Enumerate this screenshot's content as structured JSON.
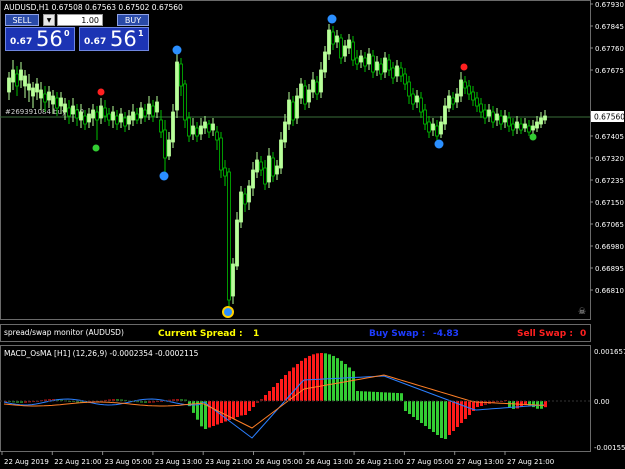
{
  "chart": {
    "header": "AUDUSD,H1  0.67508 0.67563 0.67502 0.67560",
    "symbol_icon": "chevron-down-icon",
    "price_labels": [
      "0.67930",
      "0.67845",
      "0.67760",
      "0.67675",
      "0.67560",
      "0.67490",
      "0.67405",
      "0.67320",
      "0.67235",
      "0.67150",
      "0.67065",
      "0.66980",
      "0.66895",
      "0.66810"
    ],
    "current_price": "0.67560",
    "order_line_label": "#269391084 buy 1.00",
    "order_line_color": "#3a6e3a",
    "bull_color": "#b8ff9a",
    "bear_color": "#00c000"
  },
  "trade_panel": {
    "sell_label": "SELL",
    "buy_label": "BUY",
    "lot_value": "1.00",
    "bid_small": "0.67",
    "bid_big": "56",
    "bid_sup": "0",
    "ask_small": "0.67",
    "ask_big": "56",
    "ask_sup": "1",
    "panel_color": "#1c34b4"
  },
  "monitor": {
    "title": "spread/swap monitor (AUDUSD)",
    "spread_label": "Current Spread :",
    "spread_value": "1",
    "buy_swap_label": "Buy Swap :",
    "buy_swap_value": "-4.83",
    "sell_swap_label": "Sell Swap :",
    "sell_swap_value": "0",
    "spread_color": "#ffff00",
    "buy_swap_color": "#1e3cff",
    "sell_swap_color": "#ff2020"
  },
  "macd": {
    "title": "MACD_OsMA [H1] (12,26,9)  -0.0002354 -0.0002115",
    "price_labels": [
      "0.001657",
      "0.00",
      "-0.001555"
    ],
    "colors": {
      "up": "#33cc33",
      "down": "#ff1a1a",
      "main": "#2b7fff",
      "signal": "#ff7f27"
    }
  },
  "time_axis": [
    "22 Aug 2019",
    "22 Aug 21:00",
    "23 Aug 05:00",
    "23 Aug 13:00",
    "23 Aug 21:00",
    "26 Aug 05:00",
    "26 Aug 13:00",
    "26 Aug 21:00",
    "27 Aug 05:00",
    "27 Aug 13:00",
    "27 Aug 21:00"
  ]
}
